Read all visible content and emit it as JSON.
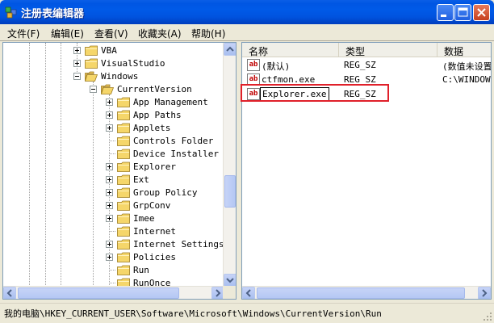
{
  "window": {
    "title": "注册表编辑器"
  },
  "menu": [
    {
      "label": "文件(F)"
    },
    {
      "label": "编辑(E)"
    },
    {
      "label": "查看(V)"
    },
    {
      "label": "收藏夹(A)"
    },
    {
      "label": "帮助(H)"
    }
  ],
  "tree": [
    {
      "label": "VBA",
      "expander": "plus"
    },
    {
      "label": "VisualStudio",
      "expander": "plus"
    },
    {
      "label": "Windows",
      "expander": "minus"
    },
    {
      "label": "CurrentVersion",
      "expander": "minus"
    },
    {
      "label": "App Management",
      "expander": "plus"
    },
    {
      "label": "App Paths",
      "expander": "plus"
    },
    {
      "label": "Applets",
      "expander": "plus"
    },
    {
      "label": "Controls Folder",
      "expander": "none"
    },
    {
      "label": "Device Installer",
      "expander": "none"
    },
    {
      "label": "Explorer",
      "expander": "plus"
    },
    {
      "label": "Ext",
      "expander": "plus"
    },
    {
      "label": "Group Policy",
      "expander": "plus"
    },
    {
      "label": "GrpConv",
      "expander": "plus"
    },
    {
      "label": "Imee",
      "expander": "plus"
    },
    {
      "label": "Internet",
      "expander": "none"
    },
    {
      "label": "Internet Settings",
      "expander": "plus"
    },
    {
      "label": "Policies",
      "expander": "plus"
    },
    {
      "label": "Run",
      "expander": "none"
    },
    {
      "label": "RunOnce",
      "expander": "none"
    }
  ],
  "list": {
    "columns": [
      "名称",
      "类型",
      "数据"
    ],
    "rows": [
      {
        "name": "(默认)",
        "type": "REG_SZ",
        "data": "(数值未设置)"
      },
      {
        "name": "ctfmon.exe",
        "type": "REG_SZ",
        "data": "C:\\WINDOWS\\"
      },
      {
        "name": "Explorer.exe",
        "type": "REG_SZ",
        "data": ""
      }
    ],
    "value_icon": "ab"
  },
  "status": {
    "path": "我的电脑\\HKEY_CURRENT_USER\\Software\\Microsoft\\Windows\\CurrentVersion\\Run"
  },
  "colors": {
    "title_blue": "#0054e3",
    "highlight_red": "#e0202a",
    "folder_yellow": "#f5d66a"
  }
}
